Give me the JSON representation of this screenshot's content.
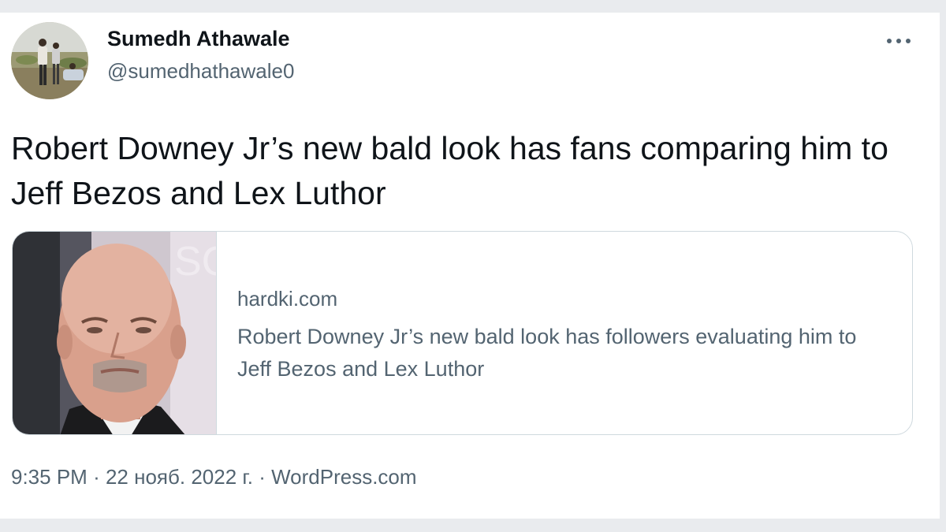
{
  "author": {
    "display_name": "Sumedh Athawale",
    "handle": "@sumedhathawale0"
  },
  "tweet": {
    "text": "Robert Downey Jr’s new bald look has fans comparing him to Jeff Bezos and Lex Luthor"
  },
  "card": {
    "domain": "hardki.com",
    "title": "Robert Downey Jr’s new bald look has followers evaluating him to Jeff Bezos and Lex Luthor",
    "image_icon": "portrait-photo"
  },
  "meta": {
    "time": "9:35 PM",
    "separator": "·",
    "date": "22 нояб. 2022 г.",
    "source": "WordPress.com"
  },
  "icons": {
    "more": "more-horizontal-icon"
  },
  "colors": {
    "primary_text": "#0f1419",
    "secondary_text": "#536471",
    "border": "#cfd9de"
  }
}
